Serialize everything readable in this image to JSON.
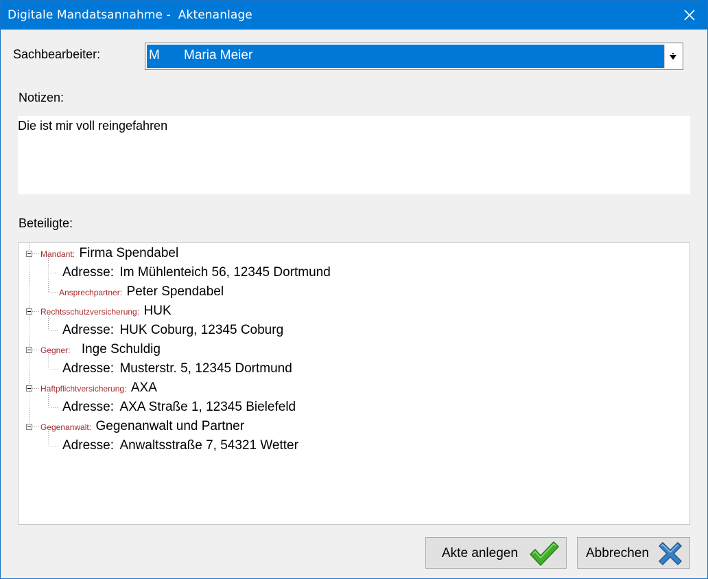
{
  "window": {
    "title": "Digitale Mandatsannahme -  Aktenanlage"
  },
  "sachbearbeiter": {
    "label": "Sachbearbeiter:",
    "code": "M",
    "name": "Maria Meier"
  },
  "notizen": {
    "label": "Notizen:",
    "text": "Die ist mir voll reingefahren"
  },
  "beteiligte": {
    "label": "Beteiligte:",
    "nodes": [
      {
        "role": "Mandant:",
        "value": "Firma Spendabel",
        "children": [
          {
            "label": "Adresse:",
            "value": "Im Mühlenteich 56, 12345 Dortmund"
          },
          {
            "role": "Ansprechpartner:",
            "value": "Peter Spendabel"
          }
        ]
      },
      {
        "role": "Rechtsschutzversicherung:",
        "value": "HUK",
        "children": [
          {
            "label": "Adresse:",
            "value": "HUK Coburg, 12345 Coburg"
          }
        ]
      },
      {
        "role": "Gegner:",
        "value": "Inge Schuldig",
        "children": [
          {
            "label": "Adresse:",
            "value": "Musterstr. 5, 12345 Dortmund"
          }
        ]
      },
      {
        "role": "Haftpflichtversicherung:",
        "value": "AXA",
        "children": [
          {
            "label": "Adresse:",
            "value": "AXA Straße 1, 12345 Bielefeld"
          }
        ]
      },
      {
        "role": "Gegenanwalt:",
        "value": "Gegenanwalt und Partner",
        "children": [
          {
            "label": "Adresse:",
            "value": "Anwaltsstraße 7, 54321 Wetter"
          }
        ]
      }
    ]
  },
  "buttons": {
    "create": "Akte anlegen",
    "cancel": "Abbrechen"
  },
  "colors": {
    "titlebar": "#0078d7",
    "selection": "#0078d7",
    "role_text": "#a52a2a",
    "check_icon": "#3fae29",
    "cancel_icon": "#3a7fc1"
  },
  "icons": {
    "close": "close-icon",
    "dropdown": "chevron-down-icon",
    "create": "checkmark-icon",
    "cancel": "x-icon"
  }
}
